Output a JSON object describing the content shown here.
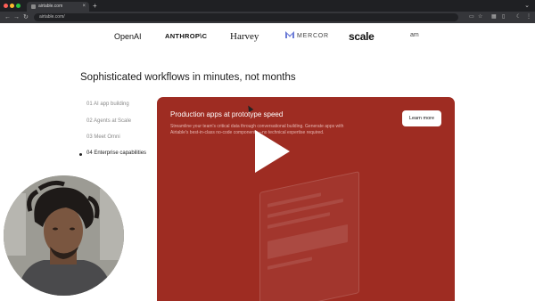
{
  "browser": {
    "tab_title": "airtable.com",
    "tab_close": "×",
    "new_tab": "+",
    "url": "airtable.com/",
    "window_controls": "⌄"
  },
  "logos": {
    "openai": "OpenAI",
    "anthropic": "ANTHROP\\C",
    "harvey": "Harvey",
    "mercor": "MERCOR",
    "scale": "scale",
    "partial": "am"
  },
  "headline": "Sophisticated workflows in minutes, not months",
  "menu": {
    "items": [
      {
        "label": "01 AI app building"
      },
      {
        "label": "02 Agents at Scale"
      },
      {
        "label": "03 Meet Omni"
      },
      {
        "label": "04 Enterprise capabilities"
      }
    ]
  },
  "panel": {
    "title": "Production apps at prototype speed",
    "description": "Streamline your team's critical data through conversational building. Generate apps with Airtable's best-in-class no-code components—no technical expertise required.",
    "button_label": "Learn more"
  },
  "colors": {
    "panel_bg": "#9e2c22",
    "chrome_dark": "#1f2023",
    "toolbar": "#35363a"
  }
}
